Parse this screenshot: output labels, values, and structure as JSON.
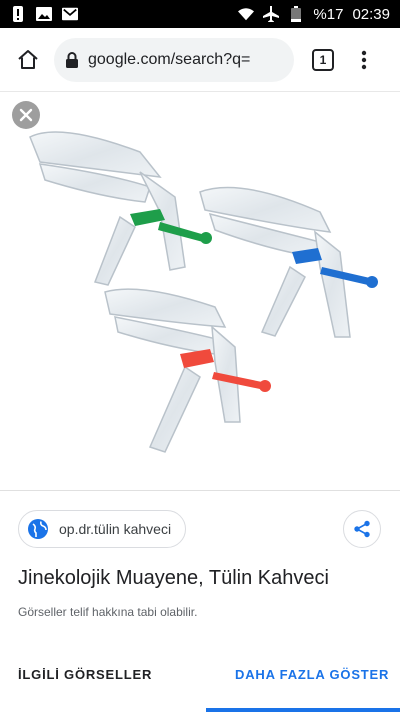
{
  "status_bar": {
    "battery": "%17",
    "time": "02:39",
    "icons": [
      "notification-alert-icon",
      "image-icon",
      "gmail-icon",
      "wifi-icon",
      "airplane-icon",
      "battery-icon"
    ]
  },
  "browser": {
    "url": "google.com/search?q=",
    "tab_count": "1",
    "icons": [
      "home-icon",
      "lock-icon",
      "tab-switcher-icon",
      "more-vert-icon"
    ]
  },
  "image_viewer": {
    "close_icon": "close-icon",
    "image_subject": "three transparent plastic speculums with green, blue and red screws"
  },
  "result": {
    "source": "op.dr.tülin kahveci",
    "title": "Jinekolojik Muayene, Tülin Kahveci",
    "copyright_note": "Görseller telif hakkına tabi olabilir.",
    "related_label": "İLGİLİ GÖRSELLER",
    "more_label": "DAHA FAZLA GÖSTER"
  },
  "colors": {
    "accent": "#1a73e8",
    "green_screw": "#1e9e4a",
    "blue_screw": "#1f6fd1",
    "red_screw": "#f04a3c"
  }
}
